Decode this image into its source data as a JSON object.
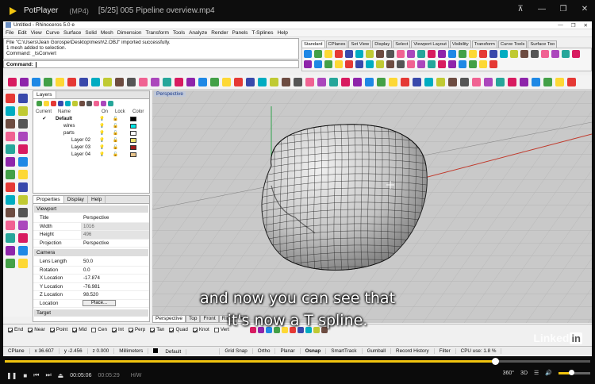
{
  "player": {
    "name": "PotPlayer",
    "format": "(MP4)",
    "file": "[5/25] 005 Pipeline overview.mp4",
    "window_controls": [
      "pin-icon",
      "minimize-icon",
      "maximize-icon",
      "close-icon"
    ]
  },
  "rhino": {
    "title": "Untitled - Rhinoceros 5.0 e",
    "menu": [
      "File",
      "Edit",
      "View",
      "Curve",
      "Surface",
      "Solid",
      "Mesh",
      "Dimension",
      "Transform",
      "Tools",
      "Analyze",
      "Render",
      "Panels",
      "T-Splines",
      "Help"
    ],
    "history": [
      "File \"C:\\Users\\Jean Gorospe\\Desktop\\mesh\\2.OBJ\" imported successfully.",
      "1 mesh added to selection.",
      "Command: _tsConvert"
    ],
    "command_label": "Command:",
    "toolbar_tabs": [
      "Standard",
      "CPlanes",
      "Set View",
      "Display",
      "Select",
      "Viewport Layout",
      "Visibility",
      "Transform",
      "Curve Tools",
      "Surface Too"
    ],
    "layers": {
      "tabs": [
        "Layers"
      ],
      "columns": [
        "Current",
        "Name",
        "On",
        "Lock",
        "Color"
      ],
      "rows": [
        {
          "name": "Default",
          "indent": 0,
          "current": true,
          "color": "#000000",
          "bold": true
        },
        {
          "name": "wires",
          "indent": 1,
          "current": false,
          "color": "#00e5e5"
        },
        {
          "name": "parts",
          "indent": 1,
          "current": false,
          "color": "#ffffff",
          "expand": "⊟"
        },
        {
          "name": "Layer 02",
          "indent": 2,
          "current": false,
          "color": "#f0e26b"
        },
        {
          "name": "Layer 03",
          "indent": 2,
          "current": false,
          "color": "#a01a1a"
        },
        {
          "name": "Layer 04",
          "indent": 2,
          "current": false,
          "color": "#e7c38b"
        }
      ]
    },
    "properties": {
      "tabs": [
        "Properties",
        "Display",
        "Help"
      ],
      "viewport_section": "Viewport",
      "viewport": [
        {
          "k": "Title",
          "v": "Perspective"
        },
        {
          "k": "Width",
          "v": "1016",
          "gray": true
        },
        {
          "k": "Height",
          "v": "496",
          "gray": true
        },
        {
          "k": "Projection",
          "v": "Perspective"
        }
      ],
      "camera_section": "Camera",
      "camera": [
        {
          "k": "Lens Length",
          "v": "50.0"
        },
        {
          "k": "Rotation",
          "v": "0.0"
        },
        {
          "k": "X Location",
          "v": "-17.874"
        },
        {
          "k": "Y Location",
          "v": "-76.981"
        },
        {
          "k": "Z Location",
          "v": "98.520"
        }
      ],
      "location": {
        "k": "Location",
        "btn": "Place..."
      },
      "target_section": "Target"
    },
    "viewport_label": "Perspective",
    "view_tabs": [
      "Perspective",
      "Top",
      "Front",
      "Right"
    ],
    "osnap": [
      {
        "label": "End",
        "on": true
      },
      {
        "label": "Near",
        "on": true
      },
      {
        "label": "Point",
        "on": true
      },
      {
        "label": "Mid",
        "on": true
      },
      {
        "label": "Cen",
        "on": false
      },
      {
        "label": "Int",
        "on": true
      },
      {
        "label": "Perp",
        "on": true
      },
      {
        "label": "Tan",
        "on": true
      },
      {
        "label": "Quad",
        "on": true
      },
      {
        "label": "Knot",
        "on": true
      },
      {
        "label": "Vert",
        "on": false
      }
    ],
    "status": {
      "cplane": "CPlane",
      "x": "x 36.607",
      "y": "y -2.456",
      "z": "z 0.000",
      "units": "Millimeters",
      "layer": "Default",
      "toggles": [
        "Grid Snap",
        "Ortho",
        "Planar",
        "Osnap",
        "SmartTrack",
        "Gumball",
        "Record History",
        "Filter"
      ],
      "active_toggle": "Osnap",
      "cpu": "CPU use: 1.8 %"
    }
  },
  "subtitle": {
    "line1": "and now you can see that",
    "line2": "it's now a T spline."
  },
  "watermark": {
    "text": "Linked",
    "badge": "in"
  },
  "playback": {
    "current": "00:05:06",
    "duration": "00:05:29",
    "hw": "H/W",
    "progress": 0.838,
    "volume": 0.4,
    "right_labels": [
      "360°",
      "3D"
    ]
  },
  "colors": {
    "accent": "#f1c40f",
    "viewport_bg": "#c9c9c9",
    "mesh": "#cfcfcf"
  }
}
